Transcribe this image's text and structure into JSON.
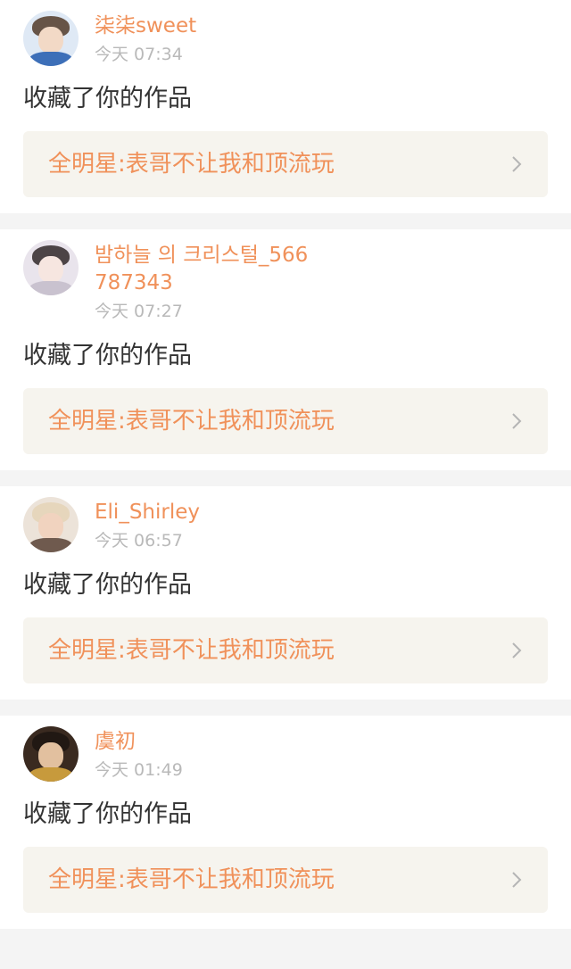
{
  "feed": [
    {
      "username": "柒柒sweet",
      "time": "今天 07:34",
      "action": "收藏了你的作品",
      "work_title": "全明星:表哥不让我和顶流玩"
    },
    {
      "username": "밤하늘 의 크리스털_566787343",
      "time": "今天 07:27",
      "action": "收藏了你的作品",
      "work_title": "全明星:表哥不让我和顶流玩"
    },
    {
      "username": "Eli_Shirley",
      "time": "今天 06:57",
      "action": "收藏了你的作品",
      "work_title": "全明星:表哥不让我和顶流玩"
    },
    {
      "username": "虞初",
      "time": "今天 01:49",
      "action": "收藏了你的作品",
      "work_title": "全明星:表哥不让我和顶流玩"
    }
  ],
  "colors": {
    "accent": "#f0915a",
    "timestamp": "#b9b9b9",
    "body_text": "#333333",
    "link_bg": "#f6f4ee",
    "page_bg": "#f4f4f4"
  },
  "icons": {
    "chevron": "chevron-right-icon",
    "avatar": "avatar"
  }
}
